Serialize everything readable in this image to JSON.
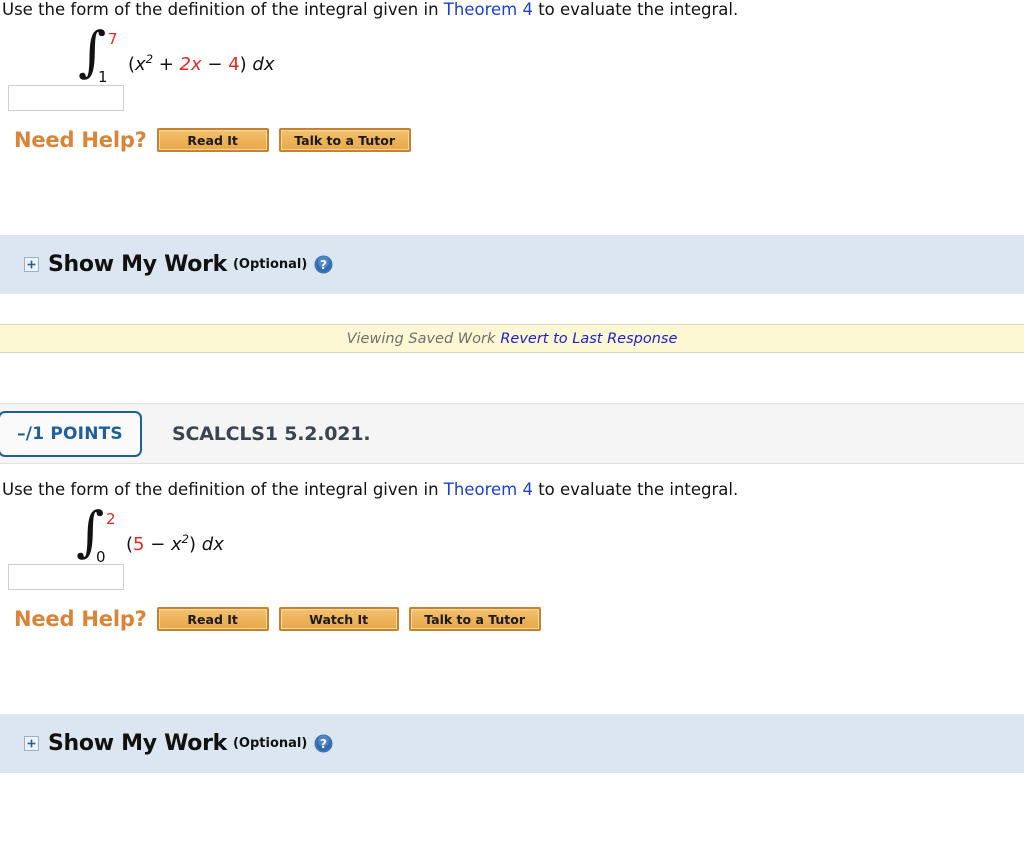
{
  "questions": [
    {
      "prompt_before": "Use the form of the definition of the integral given in ",
      "prompt_link": "Theorem 4",
      "prompt_after": " to evaluate the integral.",
      "integral": {
        "sign": "∫",
        "upper_limit": "7",
        "lower_limit": "1",
        "integrand_open": "(",
        "integrand_var": "x",
        "integrand_exp": "2",
        "integrand_plus": " + ",
        "integrand_term2": "2x",
        "integrand_minus": " − ",
        "integrand_term3": "4",
        "integrand_close": ")",
        "differential": "dx",
        "upper_color": "#e8291c",
        "lower_color": "#111111",
        "term_color": "#e8291c"
      },
      "answer_value": "",
      "answer_placeholder": "",
      "need_help_label": "Need Help?",
      "help_buttons": [
        "Read It",
        "Talk to a Tutor"
      ]
    },
    {
      "prompt_before": "Use the form of the definition of the integral given in ",
      "prompt_link": "Theorem 4",
      "prompt_after": " to evaluate the integral.",
      "integral": {
        "sign": "∫",
        "upper_limit": "2",
        "lower_limit": "0",
        "integrand_open": "(",
        "integrand_term1": "5",
        "integrand_minus": " − ",
        "integrand_var": "x",
        "integrand_exp": "2",
        "integrand_close": ")",
        "differential": "dx",
        "upper_color": "#e8291c",
        "lower_color": "#111111",
        "term_color": "#e8291c"
      },
      "answer_value": "",
      "answer_placeholder": "",
      "need_help_label": "Need Help?",
      "help_buttons": [
        "Read It",
        "Watch It",
        "Talk to a Tutor"
      ]
    }
  ],
  "show_my_work": {
    "title": "Show My Work",
    "optional_label": "(Optional)",
    "expand_symbol": "+",
    "help_icon_symbol": "?",
    "background_color": "#dce6f0"
  },
  "saved_work_bar": {
    "status_text": "Viewing Saved Work",
    "revert_link": "Revert to Last Response",
    "background_color": "#fbf8d3",
    "status_color": "#6f6f6f",
    "link_color": "#2020cc"
  },
  "question_header": {
    "points_label": "–/1 POINTS",
    "question_code": "SCALCLS1 5.2.021.",
    "badge_border_color": "#1f5e96",
    "points_text_color": "#1f6096",
    "background_color": "#f5f5f5"
  },
  "colors": {
    "link": "#1a3fd0",
    "need_help_orange": "#d98437",
    "button_border": "#c8802a",
    "red_term": "#e8291c"
  }
}
